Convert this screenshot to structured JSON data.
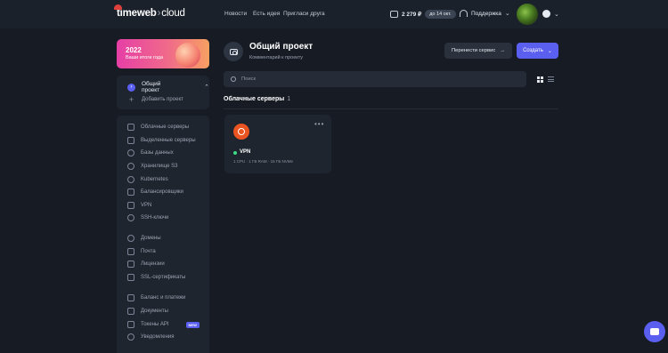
{
  "brand": {
    "name": "timeweb",
    "product": "cloud"
  },
  "nav": [
    "Новости",
    "Есть идея",
    "Пригласи друга"
  ],
  "balance": {
    "amount": "2 279 ₽",
    "until": "до 14 окт."
  },
  "support": {
    "label": "Поддержка"
  },
  "promo": {
    "year": "2022",
    "text": "Ваши итоги года"
  },
  "sidebar": {
    "project": {
      "name": "Общий проект",
      "add_label": "Добавить проект"
    },
    "group1": [
      "Облачные серверы",
      "Выделенные серверы",
      "Базы данных",
      "Хранилище S3",
      "Kubernetes",
      "Балансировщики",
      "VPN",
      "SSH-ключи"
    ],
    "group2": [
      "Домены",
      "Почта",
      "Лицензии",
      "SSL-сертификаты"
    ],
    "group3": [
      "Баланс и платежи",
      "Документы",
      "Токены API",
      "Уведомления"
    ],
    "new_badge": "NEW"
  },
  "main": {
    "title": "Общий проект",
    "subtitle": "Комментарий к проекту",
    "move_button": "Перенести сервис",
    "create_button": "Создать",
    "search_placeholder": "Поиск",
    "section_title": "Облачные серверы",
    "section_count": "1"
  },
  "server": {
    "name": "VPN",
    "specs": "1 CPU · 1 ГБ RAM · 15 ГБ NVMe",
    "os_icon": "ubuntu-icon",
    "status_color": "#3ddc84"
  },
  "colors": {
    "accent": "#5b5ff0",
    "background": "#161b24",
    "panel": "#1f252f"
  }
}
